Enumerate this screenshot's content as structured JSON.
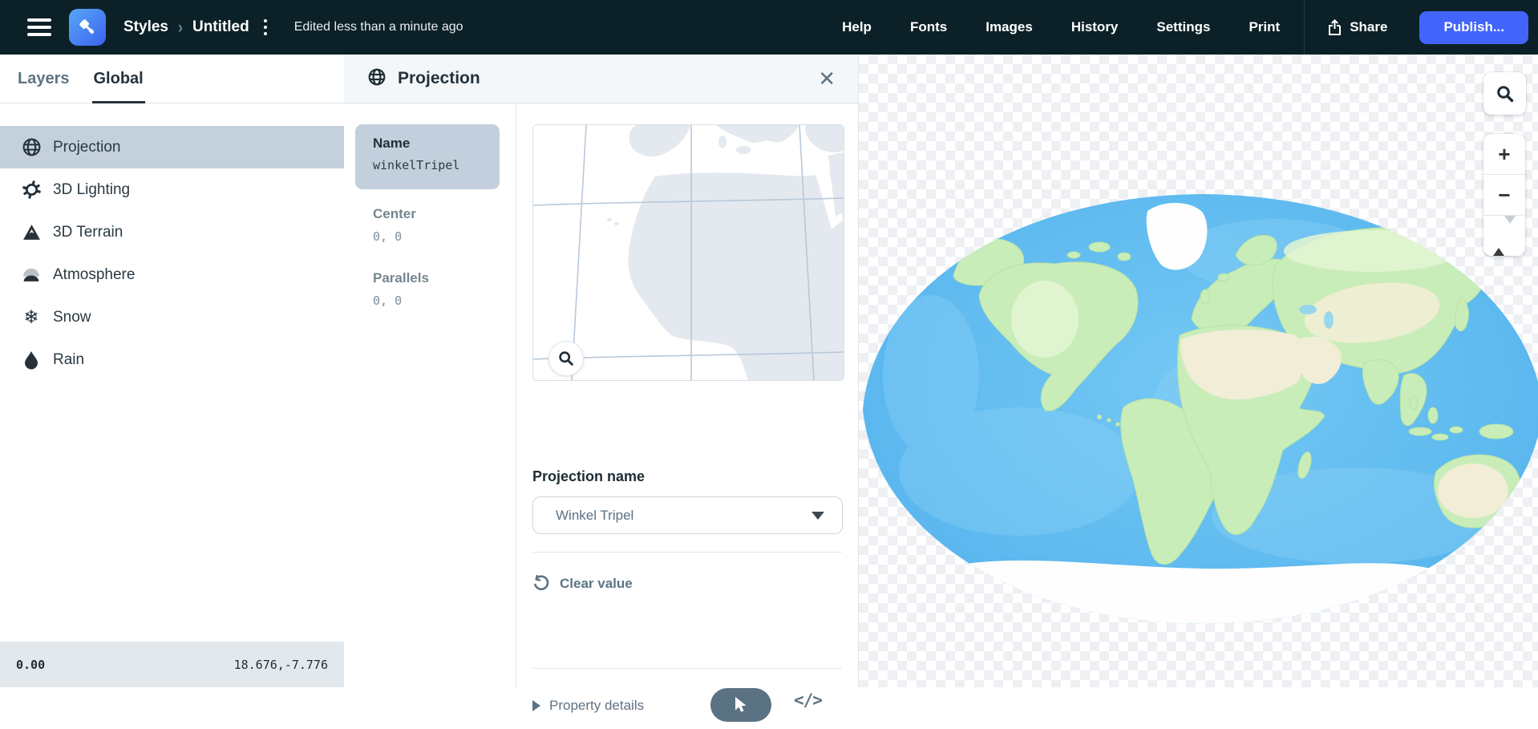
{
  "topbar": {
    "breadcrumb": {
      "section": "Styles",
      "name": "Untitled"
    },
    "edited": "Edited less than a minute ago",
    "links": [
      "Help",
      "Fonts",
      "Images",
      "History",
      "Settings",
      "Print"
    ],
    "share_label": "Share",
    "publish_label": "Publish...",
    "colors": {
      "background": "#0c2127",
      "accent": "#4264fb"
    }
  },
  "sidebar": {
    "tabs": [
      {
        "label": "Layers"
      },
      {
        "label": "Global"
      }
    ],
    "active_tab": "Global",
    "items": [
      {
        "label": "Projection",
        "icon": "globe-icon"
      },
      {
        "label": "3D Lighting",
        "icon": "lighting-gear-icon"
      },
      {
        "label": "3D Terrain",
        "icon": "mountain-icon"
      },
      {
        "label": "Atmosphere",
        "icon": "atmosphere-dome-icon"
      },
      {
        "label": "Snow",
        "icon": "snowflake-icon"
      },
      {
        "label": "Rain",
        "icon": "raindrop-icon"
      }
    ],
    "selected_item": "Projection",
    "statusbar": {
      "zoom_level": "0.00",
      "coordinates": "18.676,-7.776"
    }
  },
  "panel": {
    "title": "Projection",
    "properties": [
      {
        "label": "Name",
        "value": "winkelTripel"
      },
      {
        "label": "Center",
        "value": "0, 0"
      },
      {
        "label": "Parallels",
        "value": "0, 0"
      }
    ],
    "selected_property": "Name",
    "editor": {
      "field_label": "Projection name",
      "dropdown_value": "Winkel Tripel",
      "clear_label": "Clear value",
      "details_label": "Property details",
      "code_icon_label": "</>"
    }
  },
  "canvas": {
    "controls": {
      "zoom_in": "+",
      "zoom_out": "−"
    },
    "map": {
      "projection": "Winkel Tripel",
      "ocean_color": "#5cb9ef",
      "land_green": "#c9edb8",
      "land_tan": "#f2edd6",
      "ice_white": "#fdfefd"
    }
  }
}
